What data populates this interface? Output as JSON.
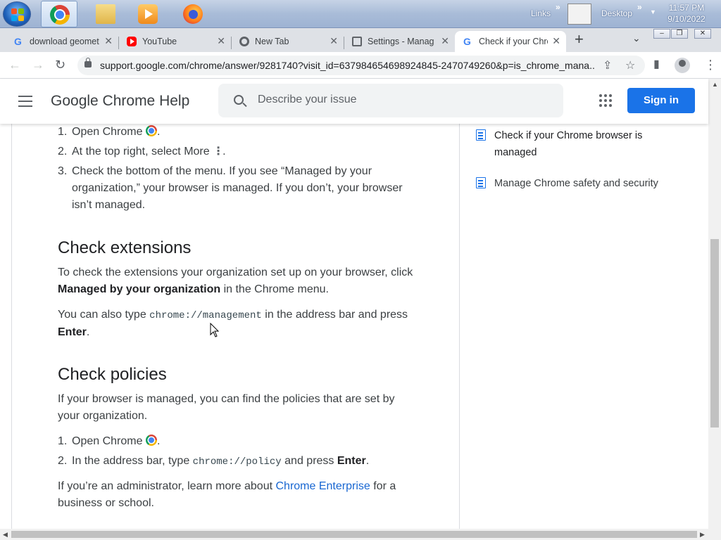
{
  "taskbar": {
    "links_label": "Links",
    "desktop_label": "Desktop",
    "clock_time": "11:57 PM",
    "clock_date": "9/10/2022"
  },
  "tabs": [
    {
      "title": "download geomet",
      "icon": "google-g-icon"
    },
    {
      "title": "YouTube",
      "icon": "youtube-icon"
    },
    {
      "title": "New Tab",
      "icon": "chrome-newtab-icon"
    },
    {
      "title": "Settings - Manag",
      "icon": "settings-page-icon"
    },
    {
      "title": "Check if your Chro",
      "icon": "google-g-icon"
    }
  ],
  "address_bar": {
    "url": "support.google.com/chrome/answer/9281740?visit_id=637984654698924845-2470749260&p=is_chrome_mana..."
  },
  "header": {
    "title": "Google Chrome Help",
    "search_placeholder": "Describe your issue",
    "signin_label": "Sign in"
  },
  "article": {
    "steps1": [
      {
        "num": "1.",
        "text": "Open Chrome"
      },
      {
        "num": "2.",
        "text": "At the top right, select More"
      },
      {
        "num": "3.",
        "text": "Check the bottom of the menu. If you see “Managed by your organization,” your browser is managed. If you don’t, your browser isn’t managed."
      }
    ],
    "ext_heading": "Check extensions",
    "ext_p1_a": "To check the extensions your organization set up on your browser, click ",
    "ext_p1_bold": "Managed by your organization",
    "ext_p1_b": " in the Chrome menu.",
    "ext_p2_a": "You can also type ",
    "ext_p2_code": "chrome://management",
    "ext_p2_b": " in the address bar and press ",
    "ext_p2_bold": "Enter",
    "ext_p2_c": ".",
    "pol_heading": "Check policies",
    "pol_p1": "If your browser is managed, you can find the policies that are set by your organization.",
    "steps2_1_num": "1.",
    "steps2_1": "Open Chrome",
    "steps2_2_num": "2.",
    "steps2_2_a": "In the address bar, type ",
    "steps2_2_code": "chrome://policy",
    "steps2_2_b": " and press ",
    "steps2_2_bold": "Enter",
    "steps2_2_c": ".",
    "admin_a": "If you’re an administrator, learn more about ",
    "admin_link": "Chrome Enterprise",
    "admin_b": " for a business or school."
  },
  "sidebar": {
    "items": [
      {
        "label": "Check if your Chrome browser is managed"
      },
      {
        "label": "Manage Chrome safety and security"
      }
    ]
  },
  "colors": {
    "accent": "#1a73e8",
    "link": "#1967d2",
    "tabstrip": "#dee1e6"
  }
}
